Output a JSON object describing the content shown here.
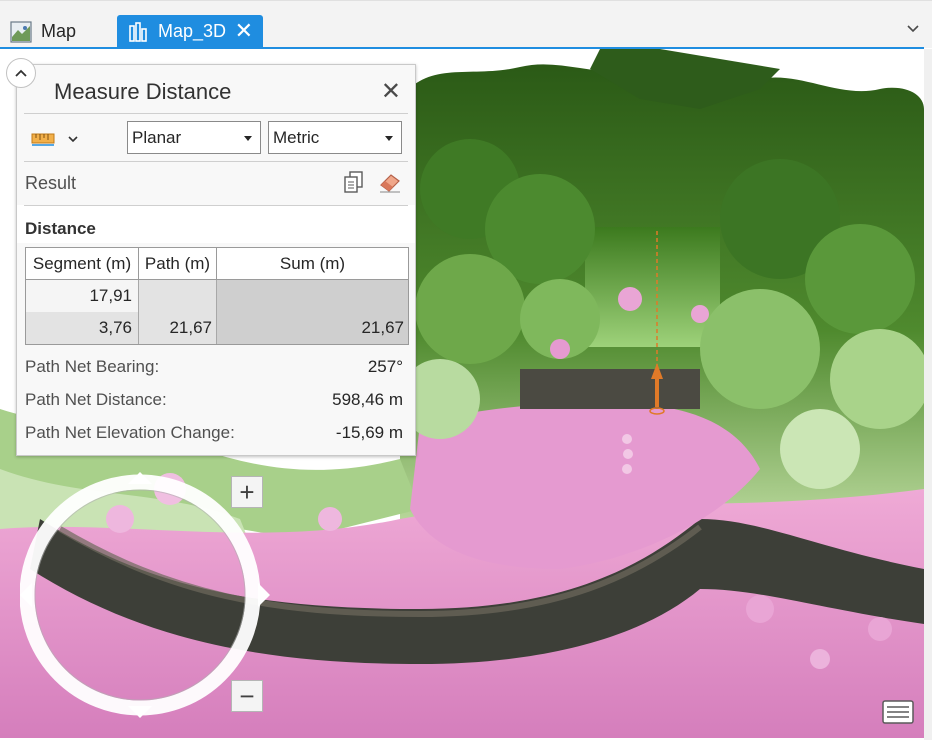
{
  "tabs": [
    {
      "label": "Map",
      "icon": "map-icon",
      "active": false
    },
    {
      "label": "Map_3D",
      "icon": "scene-icon",
      "active": true,
      "close": "✕"
    }
  ],
  "colors": {
    "accent": "#1f8de0",
    "vegetation_dark": "#2f5e1c",
    "vegetation_light": "#b9d99b",
    "ground_pink": "#df8fc8",
    "measure_line": "#e07a28"
  },
  "measure_panel": {
    "title": "Measure Distance",
    "close": "✕",
    "tool_icon": "ruler-icon",
    "mode_select": {
      "value": "Planar"
    },
    "units_select": {
      "value": "Metric"
    },
    "result_label": "Result",
    "distance_label": "Distance",
    "table": {
      "headers": {
        "segment": "Segment (m)",
        "path": "Path (m)",
        "sum": "Sum (m)"
      },
      "rows": [
        {
          "segment": "17,91",
          "path": "",
          "sum": ""
        },
        {
          "segment": "3,76",
          "path": "21,67",
          "sum": "21,67"
        }
      ]
    },
    "stats": {
      "bearing_label": "Path Net Bearing:",
      "bearing_value": "257°",
      "distance_label": "Path Net Distance:",
      "distance_value": "598,46 m",
      "elevation_label": "Path Net Elevation Change:",
      "elevation_value": "-15,69 m"
    }
  },
  "navigation": {
    "zoom_in": "+",
    "zoom_out": "−"
  }
}
